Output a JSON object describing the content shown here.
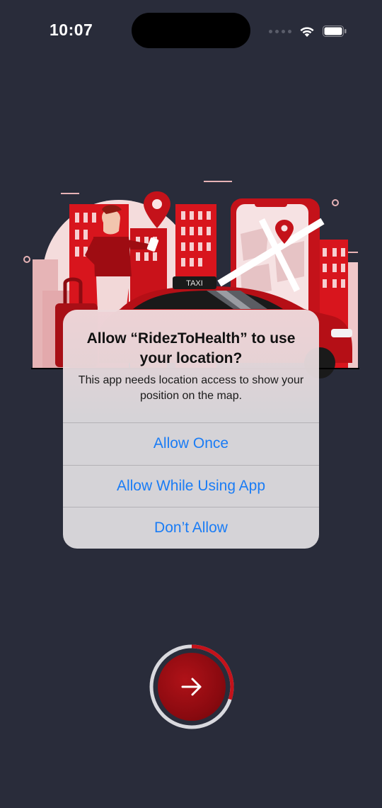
{
  "status_bar": {
    "time": "10:07",
    "icons": [
      "signal-icon",
      "wifi-icon",
      "battery-icon"
    ]
  },
  "illustration": {
    "taxi_sign": "TAXI",
    "icons": [
      "location-pin-icon",
      "map-phone-icon",
      "taxi-car-icon",
      "person-icon",
      "suitcase-icon"
    ]
  },
  "alert": {
    "title": "Allow “RidezToHealth” to use your location?",
    "message": "This app needs location access to show your position on the map.",
    "buttons": {
      "allow_once": "Allow Once",
      "allow_while_using": "Allow While Using App",
      "dont_allow": "Don’t Allow"
    }
  },
  "next_button": {
    "icon": "arrow-right-icon",
    "progress": 0.3
  },
  "colors": {
    "background": "#292c3a",
    "accent_red": "#b01218",
    "link_blue": "#1a7cf5"
  }
}
